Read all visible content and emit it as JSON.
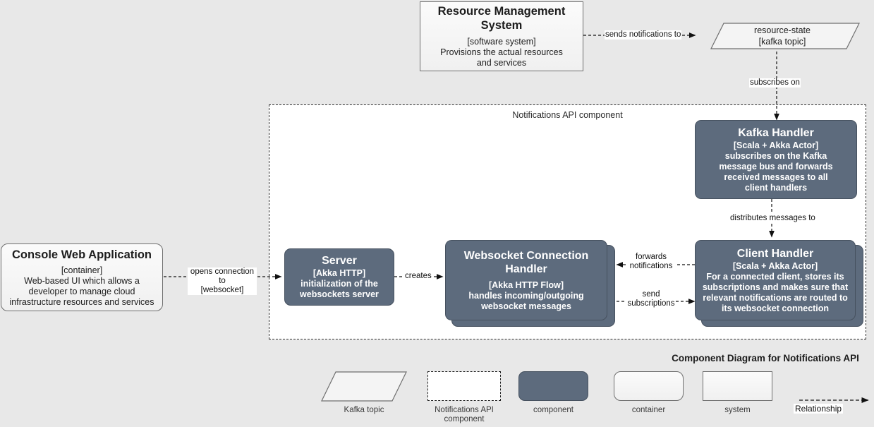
{
  "diagram": {
    "title": "Component Diagram for Notifications API",
    "boundary_label": "Notifications API component",
    "accent_color": "#5d6b7d",
    "background_color": "#e8e8e8"
  },
  "nodes": {
    "resource_management_system": {
      "title": "Resource Management System",
      "meta": "[software system]",
      "desc": "Provisions the actual resources and services",
      "shape": "system"
    },
    "kafka_topic": {
      "title": "resource-state",
      "meta": "[kafka topic]",
      "shape": "kafka-topic"
    },
    "console_web_application": {
      "title": "Console Web Application",
      "meta": "[container]",
      "desc": "Web-based UI which allows a developer to manage cloud infrastructure resources and services",
      "shape": "container"
    },
    "kafka_handler": {
      "title": "Kafka Handler",
      "meta": "[Scala + Akka Actor]",
      "desc": "subscribes on the Kafka message bus and forwards received messages to all client handlers",
      "shape": "component"
    },
    "client_handler": {
      "title": "Client Handler",
      "meta": "[Scala + Akka Actor]",
      "desc": "For a connected client, stores its subscriptions and makes sure that relevant notifications are routed to its websocket connection",
      "shape": "component-stacked"
    },
    "server": {
      "title": "Server",
      "meta": "[Akka HTTP]",
      "desc": "initialization of the websockets server",
      "shape": "component"
    },
    "websocket_connection_handler": {
      "title": "Websocket Connection Handler",
      "meta": "[Akka HTTP Flow]",
      "desc": "handles incoming/outgoing websocket messages",
      "shape": "component-stacked"
    }
  },
  "edges": {
    "sends_notifications_to": "sends notifications to",
    "subscribes_on": "subscribes on",
    "distributes_messages_to": "distributes messages to",
    "opens_connection_to": "opens connection to\n[websocket]",
    "creates": "creates",
    "forwards_notifications": "forwards\nnotifications",
    "send_subscriptions": "send\nsubscriptions"
  },
  "legend": {
    "kafka_topic": "Kafka topic",
    "notifications_api_component": "Notifications API component",
    "component": "component",
    "container": "container",
    "system": "system",
    "relationship": "Relationship"
  }
}
